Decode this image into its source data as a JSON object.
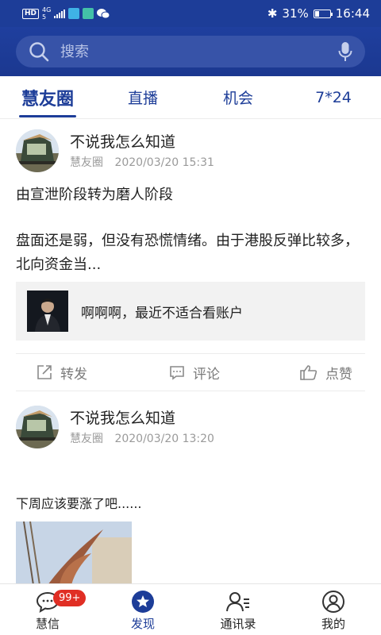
{
  "status_bar": {
    "hd": "HD",
    "net": "4G",
    "net_sub": "5",
    "bluetooth": "✱",
    "battery_percent": "31%",
    "battery_level": 0.31,
    "time": "16:44"
  },
  "search": {
    "placeholder": "搜索"
  },
  "tabs": [
    {
      "label": "慧友圈",
      "active": true
    },
    {
      "label": "直播",
      "active": false
    },
    {
      "label": "机会",
      "active": false
    },
    {
      "label": "7*24",
      "active": false
    }
  ],
  "posts": [
    {
      "author": "不说我怎么知道",
      "source": "慧友圈",
      "time": "2020/03/20 15:31",
      "body_line1": "由宣泄阶段转为磨人阶段",
      "body_line2": "盘面还是弱，但没有恐慌情绪。由于港股反弹比较多，北向资金当...",
      "quote_text": "啊啊啊，最近不适合看账户",
      "actions": {
        "share": "转发",
        "comment": "评论",
        "like": "点赞"
      }
    },
    {
      "author": "不说我怎么知道",
      "source": "慧友圈",
      "time": "2020/03/20 13:20",
      "body_line1": "下周应该要涨了吧......"
    }
  ],
  "bottom_nav": [
    {
      "label": "慧信",
      "badge": "99+",
      "icon": "chat-bubble-icon"
    },
    {
      "label": "发现",
      "icon": "star-circle-icon",
      "active": true
    },
    {
      "label": "通讯录",
      "icon": "contacts-icon"
    },
    {
      "label": "我的",
      "icon": "profile-icon"
    }
  ],
  "colors": {
    "primary": "#1d3d98",
    "badge": "#e02e24"
  }
}
